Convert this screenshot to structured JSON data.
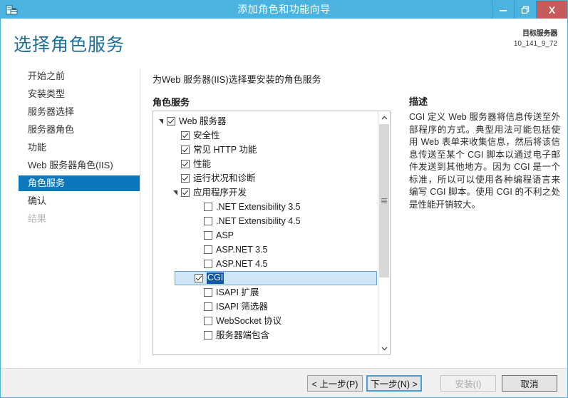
{
  "window": {
    "title": "添加角色和功能向导",
    "icon": "server-wizard-icon",
    "minimize_label": "—",
    "restore_label": "❐",
    "close_label": "X"
  },
  "header": {
    "page_title": "选择角色服务",
    "target_server_label": "目标服务器",
    "target_server_value": "10_141_9_72"
  },
  "sidebar": {
    "items": [
      {
        "label": "开始之前",
        "state": "normal"
      },
      {
        "label": "安装类型",
        "state": "normal"
      },
      {
        "label": "服务器选择",
        "state": "normal"
      },
      {
        "label": "服务器角色",
        "state": "normal"
      },
      {
        "label": "功能",
        "state": "normal"
      },
      {
        "label": "Web 服务器角色(IIS)",
        "state": "normal"
      },
      {
        "label": "角色服务",
        "state": "selected"
      },
      {
        "label": "确认",
        "state": "normal"
      },
      {
        "label": "结果",
        "state": "disabled"
      }
    ]
  },
  "main": {
    "instruction": "为Web 服务器(IIS)选择要安装的角色服务",
    "section_label": "角色服务",
    "tree": [
      {
        "label": "Web 服务器",
        "level": 0,
        "checked": true,
        "twisty": "expanded",
        "selected": false
      },
      {
        "label": "安全性",
        "level": 1,
        "checked": true,
        "twisty": "collapsed",
        "selected": false
      },
      {
        "label": "常见 HTTP 功能",
        "level": 1,
        "checked": true,
        "twisty": "collapsed",
        "selected": false
      },
      {
        "label": "性能",
        "level": 1,
        "checked": true,
        "twisty": "collapsed",
        "selected": false
      },
      {
        "label": "运行状况和诊断",
        "level": 1,
        "checked": true,
        "twisty": "collapsed",
        "selected": false
      },
      {
        "label": "应用程序开发",
        "level": 1,
        "checked": true,
        "twisty": "expanded",
        "selected": false
      },
      {
        "label": ".NET Extensibility 3.5",
        "level": 2,
        "checked": false,
        "twisty": "none",
        "selected": false
      },
      {
        "label": ".NET Extensibility 4.5",
        "level": 2,
        "checked": false,
        "twisty": "none",
        "selected": false
      },
      {
        "label": "ASP",
        "level": 2,
        "checked": false,
        "twisty": "none",
        "selected": false
      },
      {
        "label": "ASP.NET 3.5",
        "level": 2,
        "checked": false,
        "twisty": "none",
        "selected": false
      },
      {
        "label": "ASP.NET 4.5",
        "level": 2,
        "checked": false,
        "twisty": "none",
        "selected": false
      },
      {
        "label": "CGI",
        "level": 2,
        "checked": true,
        "twisty": "none",
        "selected": true
      },
      {
        "label": "ISAPI 扩展",
        "level": 2,
        "checked": false,
        "twisty": "none",
        "selected": false
      },
      {
        "label": "ISAPI 筛选器",
        "level": 2,
        "checked": false,
        "twisty": "none",
        "selected": false
      },
      {
        "label": "WebSocket 协议",
        "level": 2,
        "checked": false,
        "twisty": "none",
        "selected": false
      },
      {
        "label": "服务器端包含",
        "level": 2,
        "checked": false,
        "twisty": "none",
        "selected": false
      }
    ],
    "scrollbar": {
      "up_arrow": "⌃",
      "down_arrow": "⌄"
    }
  },
  "description": {
    "title": "描述",
    "body": "CGI 定义 Web 服务器将信息传送至外部程序的方式。典型用法可能包括使用 Web 表单来收集信息，然后将该信息传送至某个 CGI 脚本以通过电子邮件发送到其他地方。因为 CGI 是一个标准，所以可以使用各种编程语言来编写 CGI 脚本。使用 CGI 的不利之处是性能开销较大。"
  },
  "footer": {
    "prev_label": "< 上一步(P)",
    "next_label": "下一步(N) >",
    "install_label": "安装(I)",
    "cancel_label": "取消"
  },
  "colors": {
    "titlebar": "#4bb3e0",
    "close_button": "#c75b5b",
    "accent_title": "#1f6f96",
    "nav_selected": "#0b77bd",
    "row_selected_bg": "#cfe6f7",
    "text_selection": "#1157a8"
  }
}
